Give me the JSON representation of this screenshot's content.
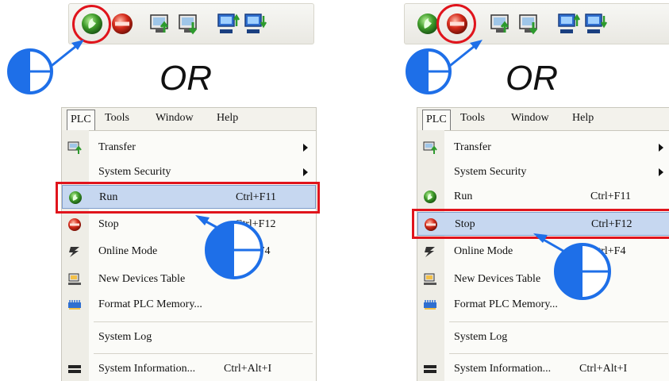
{
  "or_label": "OR",
  "menubar": [
    "PLC",
    "Tools",
    "Window",
    "Help"
  ],
  "menu_items": {
    "transfer": "Transfer",
    "system_security": "System Security",
    "run": "Run",
    "run_shortcut": "Ctrl+F11",
    "stop": "Stop",
    "stop_shortcut": "Ctrl+F12",
    "online_mode": "Online Mode",
    "online_shortcut": "Ctrl+F4",
    "new_devices_table": "New Devices Table",
    "format_plc_memory": "Format PLC Memory...",
    "system_log": "System Log",
    "system_information": "System Information...",
    "system_information_shortcut": "Ctrl+Alt+I"
  },
  "toolbar_buttons": [
    "run-icon",
    "stop-icon",
    "upload-icon",
    "download-icon",
    "monitor-upload-icon",
    "monitor-download-icon"
  ],
  "colors": {
    "highlight_ring": "#e0141c",
    "menu_highlight": "#c6d7f0",
    "cursor_blue": "#1e6fe8",
    "run_green": "#3f9b2a",
    "stop_red": "#d42a1a"
  }
}
